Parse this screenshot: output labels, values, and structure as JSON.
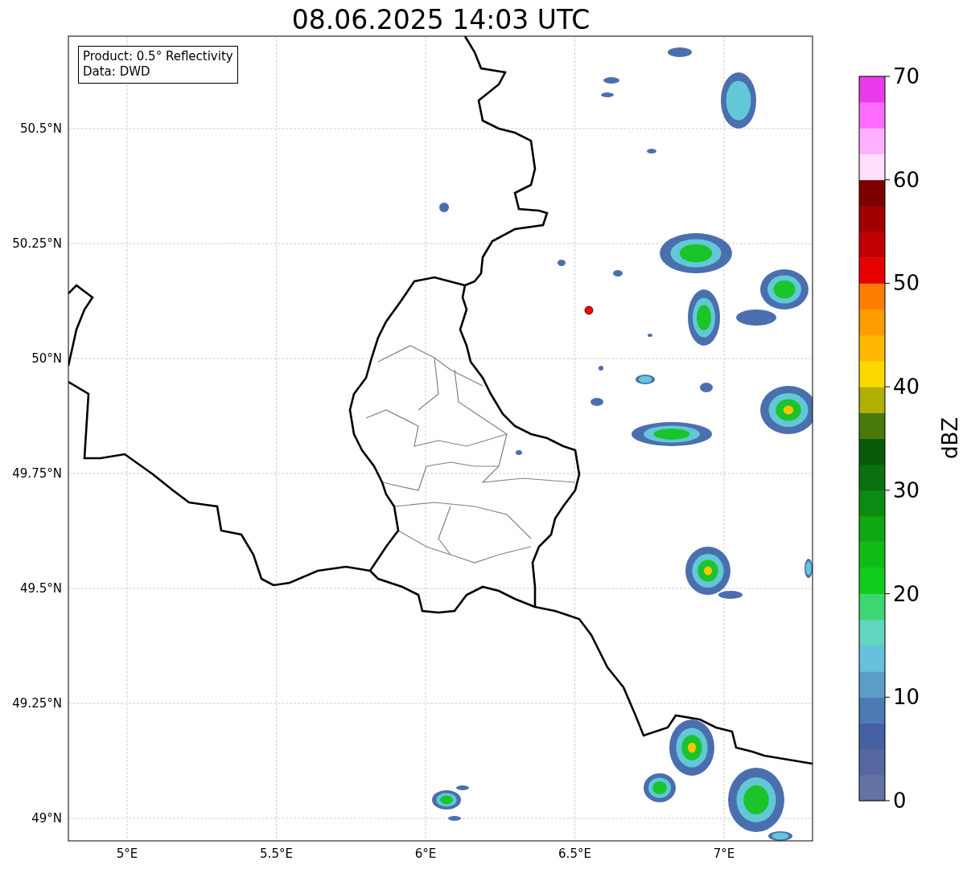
{
  "title": "08.06.2025 14:03 UTC",
  "info_box": {
    "lines": [
      "Product: 0.5° Reflectivity",
      "Data: DWD"
    ]
  },
  "map": {
    "y_labels": [
      "50.5°N",
      "50.25°N",
      "50°N",
      "49.75°N",
      "49.5°N",
      "49.25°N",
      "49°N"
    ],
    "x_labels": [
      "5°E",
      "5.5°E",
      "6°E",
      "6.5°E",
      "7°E"
    ]
  },
  "colorbar": {
    "label": "dBZ",
    "ticks": [
      "70",
      "60",
      "50",
      "40",
      "30",
      "20",
      "10",
      "0"
    ],
    "bins": [
      {
        "color": "#6472a4"
      },
      {
        "color": "#5568a0"
      },
      {
        "color": "#4560a3"
      },
      {
        "color": "#4b7ab4"
      },
      {
        "color": "#5b9ec8"
      },
      {
        "color": "#66c1dc"
      },
      {
        "color": "#60d6c0"
      },
      {
        "color": "#3ed672"
      },
      {
        "color": "#12cc1c"
      },
      {
        "color": "#10bb18"
      },
      {
        "color": "#0fa812"
      },
      {
        "color": "#0c8a12"
      },
      {
        "color": "#0a7010"
      },
      {
        "color": "#085a0a"
      },
      {
        "color": "#4a7a0a"
      },
      {
        "color": "#b0b000"
      },
      {
        "color": "#ffd800"
      },
      {
        "color": "#ffb800"
      },
      {
        "color": "#ff9c00"
      },
      {
        "color": "#ff7e00"
      },
      {
        "color": "#e60000"
      },
      {
        "color": "#c00000"
      },
      {
        "color": "#a00000"
      },
      {
        "color": "#7b0000"
      },
      {
        "color": "#ffe0ff"
      },
      {
        "color": "#ffb0ff"
      },
      {
        "color": "#ff6cff"
      },
      {
        "color": "#ea3bea"
      }
    ]
  }
}
